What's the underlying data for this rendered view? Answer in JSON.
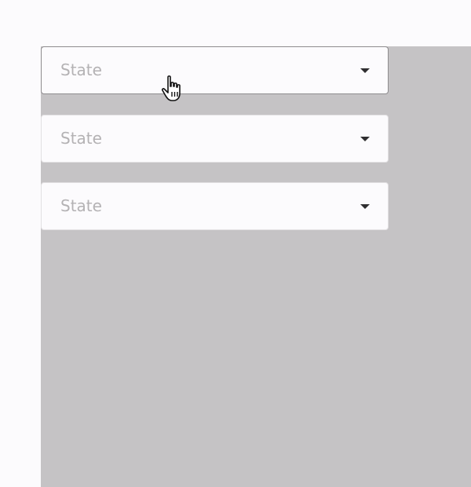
{
  "selects": [
    {
      "placeholder": "State",
      "state": "hover"
    },
    {
      "placeholder": "State",
      "state": "default"
    },
    {
      "placeholder": "State",
      "state": "default"
    }
  ],
  "cursor": {
    "type": "pointer-hand"
  },
  "colors": {
    "page_background": "#fcfbfd",
    "overlay_background": "#c5c3c5",
    "select_background": "#fcfbfd",
    "placeholder_text": "#b4b2b4",
    "caret": "#2f2e30",
    "hover_border": "#8e8c8e"
  }
}
